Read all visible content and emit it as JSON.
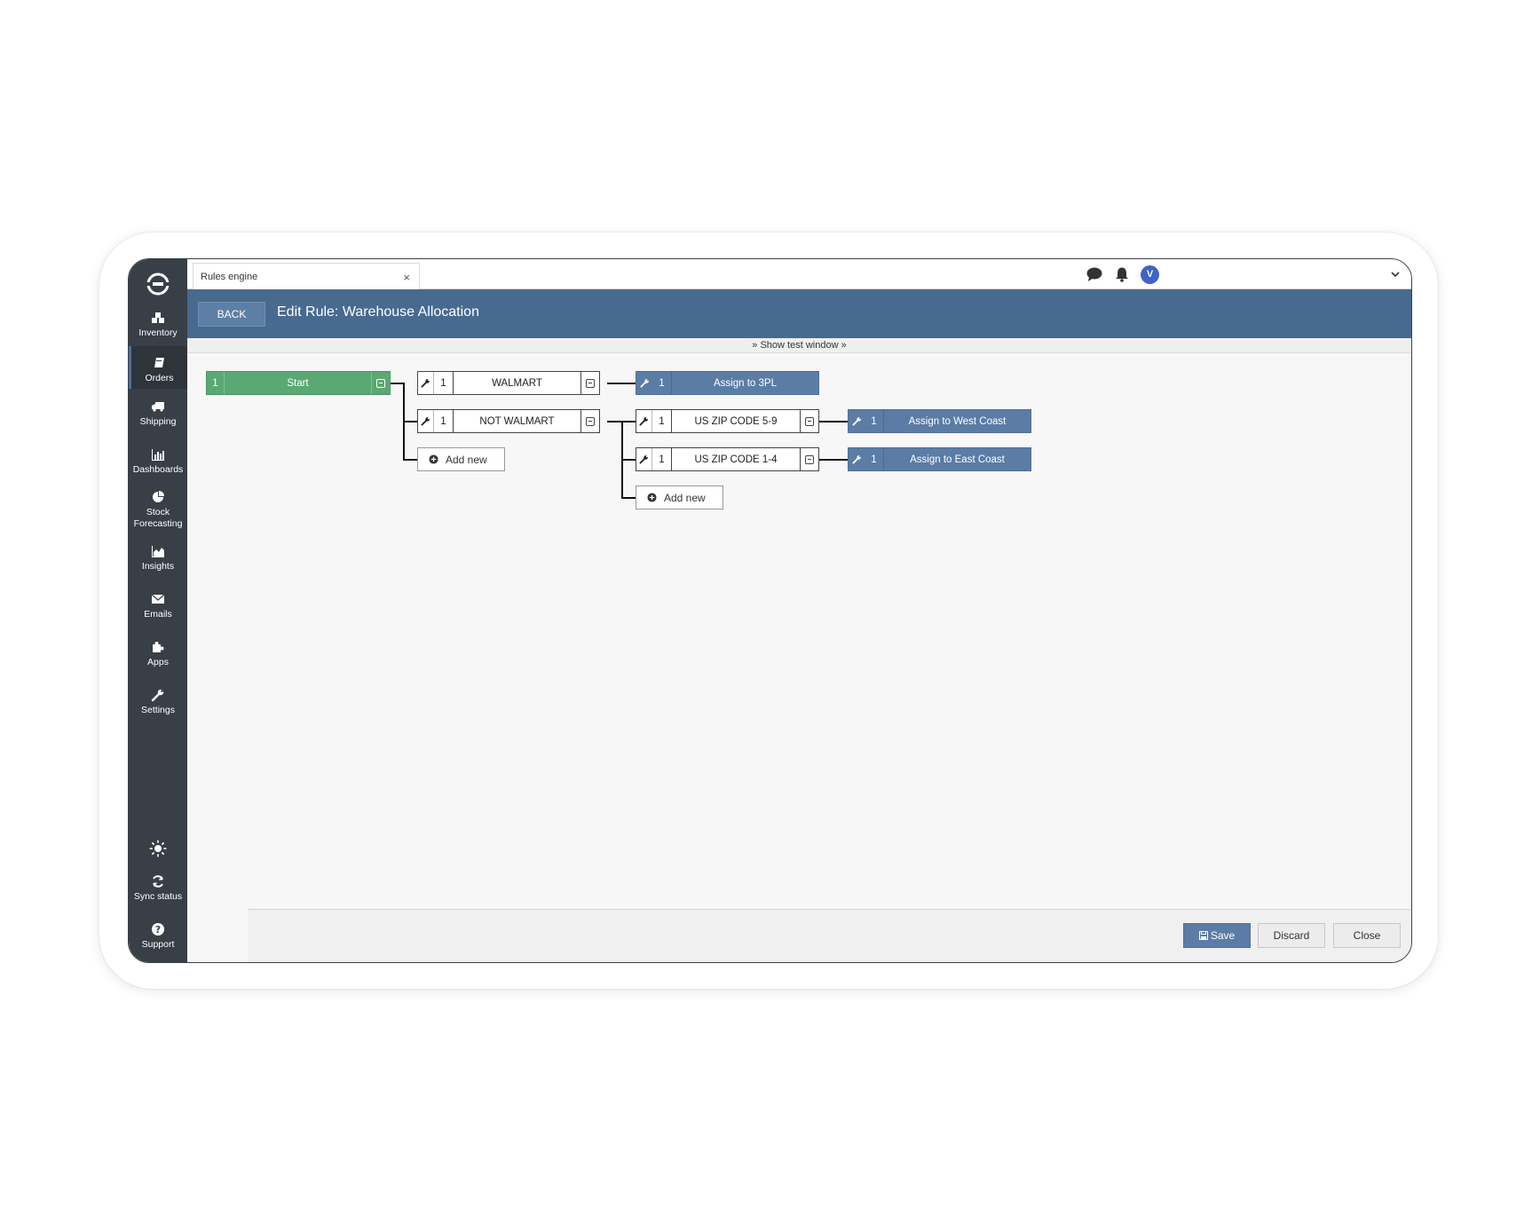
{
  "window": {
    "tab_title": "Rules engine",
    "tab_close": "×",
    "avatar_initial": "V"
  },
  "sidebar": {
    "items": [
      {
        "label": "Inventory",
        "icon": "cubes-icon"
      },
      {
        "label": "Orders",
        "icon": "book-icon",
        "active": true
      },
      {
        "label": "Shipping",
        "icon": "truck-icon"
      },
      {
        "label": "Dashboards",
        "icon": "bar-chart-icon"
      },
      {
        "label": "Stock Forecasting",
        "icon": "pie-chart-icon"
      },
      {
        "label": "Insights",
        "icon": "area-chart-icon"
      },
      {
        "label": "Emails",
        "icon": "envelope-icon"
      },
      {
        "label": "Apps",
        "icon": "puzzle-icon"
      },
      {
        "label": "Settings",
        "icon": "wrench-icon"
      }
    ],
    "bottom": [
      {
        "label": "",
        "icon": "sun-icon"
      },
      {
        "label": "Sync status",
        "icon": "sync-icon"
      },
      {
        "label": "Support",
        "icon": "question-icon"
      }
    ]
  },
  "header": {
    "back_label": "BACK",
    "title": "Edit Rule: Warehouse Allocation"
  },
  "test_window": {
    "label": "Show test window"
  },
  "rules": {
    "start": {
      "num": "1",
      "label": "Start"
    },
    "walmart": {
      "num": "1",
      "label": "WALMART"
    },
    "not_walmart": {
      "num": "1",
      "label": "NOT WALMART"
    },
    "assign_3pl": {
      "num": "1",
      "label": "Assign to 3PL"
    },
    "zip_59": {
      "num": "1",
      "label": "US ZIP CODE 5-9"
    },
    "zip_14": {
      "num": "1",
      "label": "US ZIP CODE 1-4"
    },
    "assign_west": {
      "num": "1",
      "label": "Assign to West Coast"
    },
    "assign_east": {
      "num": "1",
      "label": "Assign to East Coast"
    },
    "add_new_label": "Add new"
  },
  "footer": {
    "save_label": "Save",
    "discard_label": "Discard",
    "close_label": "Close"
  },
  "colors": {
    "sidebar": "#393f47",
    "header": "#476a8f",
    "start": "#5aa873",
    "action": "#5b7ca5",
    "avatar": "#3f63c9"
  }
}
